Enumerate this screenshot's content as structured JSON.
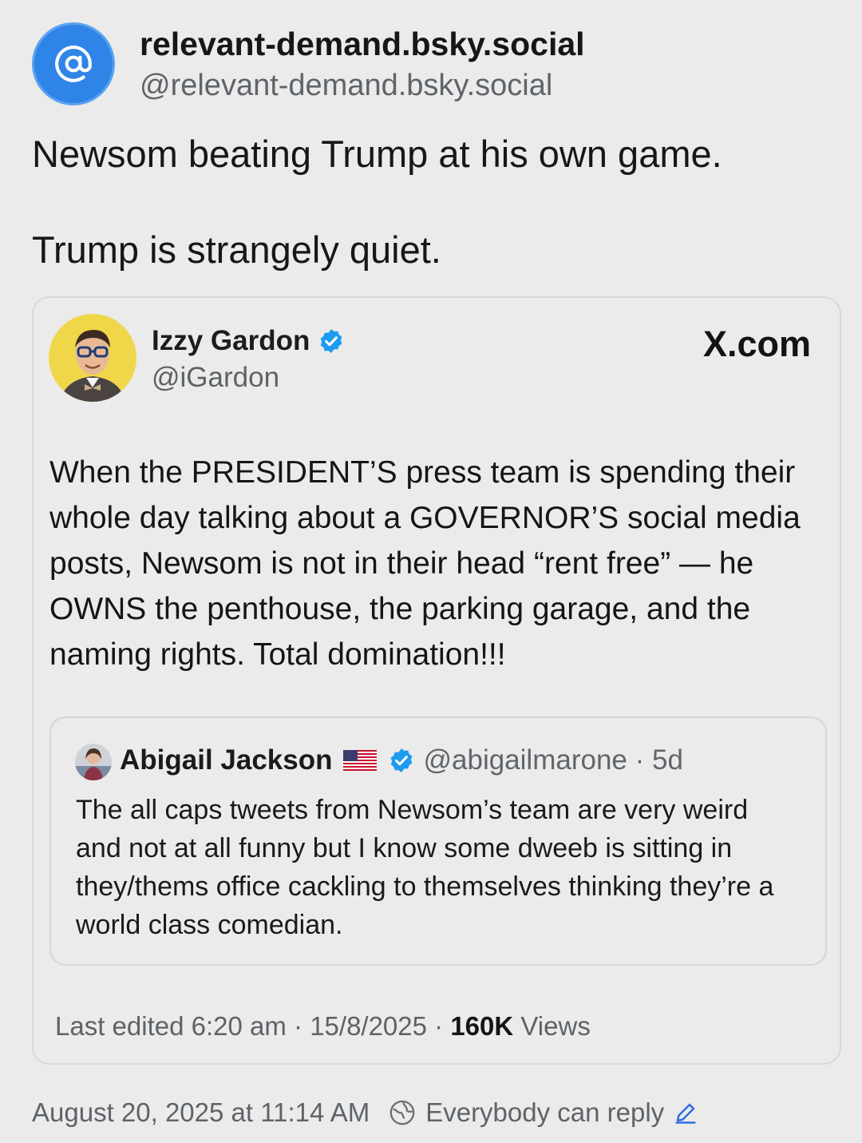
{
  "post": {
    "author_display_name": "relevant-demand.bsky.social",
    "author_handle": "@relevant-demand.bsky.social",
    "text_line_1": "Newsom beating Trump at his own game.",
    "text_line_2": "Trump is strangely quiet.",
    "timestamp": "August 20, 2025 at 11:14 AM",
    "reply_setting": "Everybody can reply",
    "avatar_icon": "at-sign-icon",
    "accent_color": "#2f84e8"
  },
  "embed": {
    "source_label": "X.com",
    "author_name": "Izzy Gardon",
    "author_handle": "@iGardon",
    "text": "When the PRESIDENT’S press team is spending their whole day talking about a GOVERNOR’S social media posts, Newsom is not in their head “rent free” — he OWNS the penthouse, the parking garage, and the naming rights. Total domination!!!",
    "meta_prefix": "Last edited 6:20 am · 15/8/2025 · ",
    "views_count": "160K",
    "views_label": " Views",
    "quote": {
      "author_name": "Abigail Jackson",
      "author_handle": "@abigailmarone · 5d",
      "text": "The all caps tweets from Newsom’s team are very weird and not at all funny but I know some dweeb is sitting in they/thems office cackling to themselves thinking they’re a world class comedian."
    }
  }
}
